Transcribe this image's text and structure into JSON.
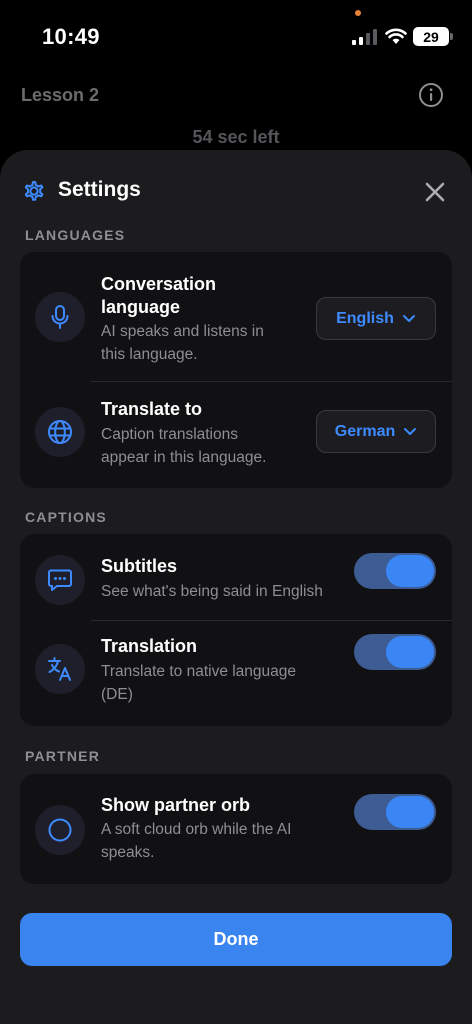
{
  "status_bar": {
    "time": "10:49",
    "battery": "29"
  },
  "background": {
    "lesson_title": "Lesson 2",
    "time_left": "54 sec left"
  },
  "sheet": {
    "title": "Settings"
  },
  "languages": {
    "section_label": "LANGUAGES",
    "conversation": {
      "title_line1": "Conversation",
      "title_line2": "language",
      "desc_line1": "AI speaks and listens in",
      "desc_line2": "this language.",
      "value": "English"
    },
    "translate": {
      "title": "Translate to",
      "desc_line1": "Caption translations",
      "desc_line2": "appear in this language.",
      "value": "German"
    }
  },
  "captions": {
    "section_label": "CAPTIONS",
    "subtitles": {
      "title": "Subtitles",
      "desc": "See what's being said in English",
      "enabled": true
    },
    "translation": {
      "title": "Translation",
      "desc_line1": "Translate to native language",
      "desc_line2": "(DE)",
      "enabled": true
    }
  },
  "partner": {
    "section_label": "PARTNER",
    "orb": {
      "title": "Show partner orb",
      "desc_line1": "A soft cloud orb while the AI",
      "desc_line2": "speaks.",
      "enabled": true
    }
  },
  "done_label": "Done",
  "colors": {
    "accent": "#3a84f0",
    "sheet_bg": "#1c1c1e",
    "card_bg": "#111113",
    "toggle_track": "#3c5c93"
  },
  "icons": [
    "gear-icon",
    "close-icon",
    "microphone-icon",
    "globe-icon",
    "chat-bubble-icon",
    "translate-icon",
    "circle-icon",
    "chevron-down-icon",
    "info-icon"
  ]
}
